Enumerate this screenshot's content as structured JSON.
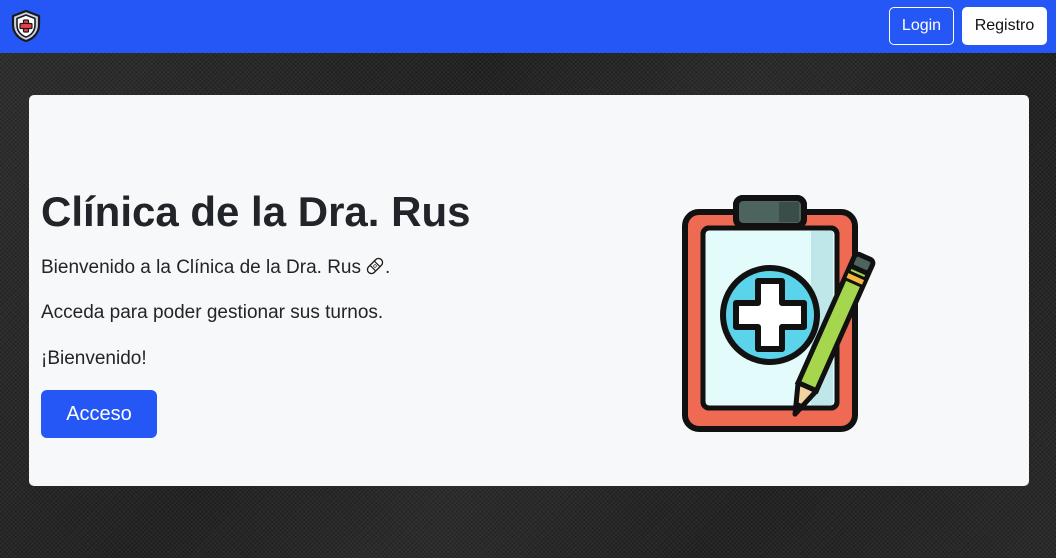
{
  "navbar": {
    "logo_icon": "shield-medical-cross-icon",
    "login_label": "Login",
    "registro_label": "Registro",
    "color": "#2457f5"
  },
  "hero": {
    "title": "Clínica de la Dra. Rus",
    "welcome_text": "Bienvenido a la Clínica de la Dra. Rus",
    "welcome_suffix": ".",
    "welcome_icon": "adhesive-bandage-icon",
    "access_text": "Acceda para poder gestionar sus turnos.",
    "greeting": "¡Bienvenido!",
    "cta_label": "Acceso",
    "illustration_icon": "medical-clipboard-pencil-icon"
  },
  "colors": {
    "accent": "#2457f5",
    "card_background": "#f7f8fa",
    "page_background": "#242424"
  }
}
